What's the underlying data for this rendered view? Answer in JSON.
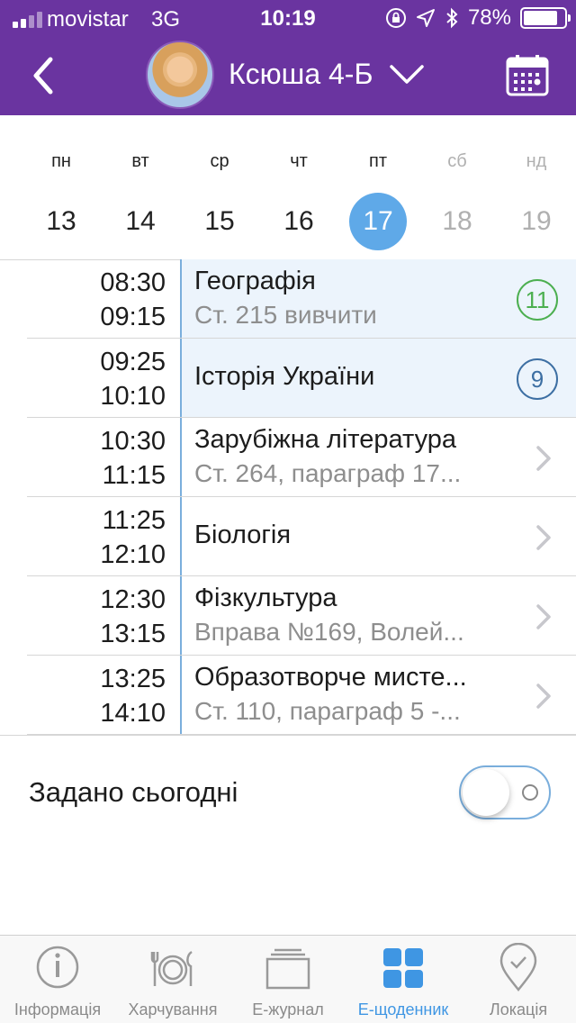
{
  "status_bar": {
    "carrier": "movistar",
    "network": "3G",
    "time": "10:19",
    "battery": "78%",
    "battery_level": 0.78
  },
  "header": {
    "student_name": "Ксюша 4-Б",
    "accent_color": "#6a34a0"
  },
  "week": [
    {
      "name": "пн",
      "date": "13",
      "weekend": false,
      "selected": false
    },
    {
      "name": "вт",
      "date": "14",
      "weekend": false,
      "selected": false
    },
    {
      "name": "ср",
      "date": "15",
      "weekend": false,
      "selected": false
    },
    {
      "name": "чт",
      "date": "16",
      "weekend": false,
      "selected": false
    },
    {
      "name": "пт",
      "date": "17",
      "weekend": false,
      "selected": true
    },
    {
      "name": "сб",
      "date": "18",
      "weekend": true,
      "selected": false
    },
    {
      "name": "нд",
      "date": "19",
      "weekend": true,
      "selected": false
    }
  ],
  "lessons": [
    {
      "start": "08:30",
      "end": "09:15",
      "subject": "Географія",
      "task": "Ст. 215 вивчити",
      "grade": "11",
      "grade_color": "green"
    },
    {
      "start": "09:25",
      "end": "10:10",
      "subject": "Історія України",
      "task": "",
      "grade": "9",
      "grade_color": "blue"
    },
    {
      "start": "10:30",
      "end": "11:15",
      "subject": "Зарубіжна література",
      "task": "Ст. 264, параграф 17...",
      "grade": "",
      "grade_color": ""
    },
    {
      "start": "11:25",
      "end": "12:10",
      "subject": "Біологія",
      "task": "",
      "grade": "",
      "grade_color": ""
    },
    {
      "start": "12:30",
      "end": "13:15",
      "subject": "Фізкультура",
      "task": "Вправа №169, Волей...",
      "grade": "",
      "grade_color": ""
    },
    {
      "start": "13:25",
      "end": "14:10",
      "subject": "Образотворче мисте...",
      "task": "Ст. 110, параграф 5 -...",
      "grade": "",
      "grade_color": ""
    }
  ],
  "assigned_today": {
    "label": "Задано сьогодні",
    "on": false
  },
  "tabbar": [
    {
      "label": "Інформація",
      "icon": "info-icon",
      "active": false
    },
    {
      "label": "Харчування",
      "icon": "food-icon",
      "active": false
    },
    {
      "label": "Е-журнал",
      "icon": "journal-icon",
      "active": false
    },
    {
      "label": "Е-щоденник",
      "icon": "diary-grid-icon",
      "active": true
    },
    {
      "label": "Локація",
      "icon": "location-icon",
      "active": false
    }
  ]
}
